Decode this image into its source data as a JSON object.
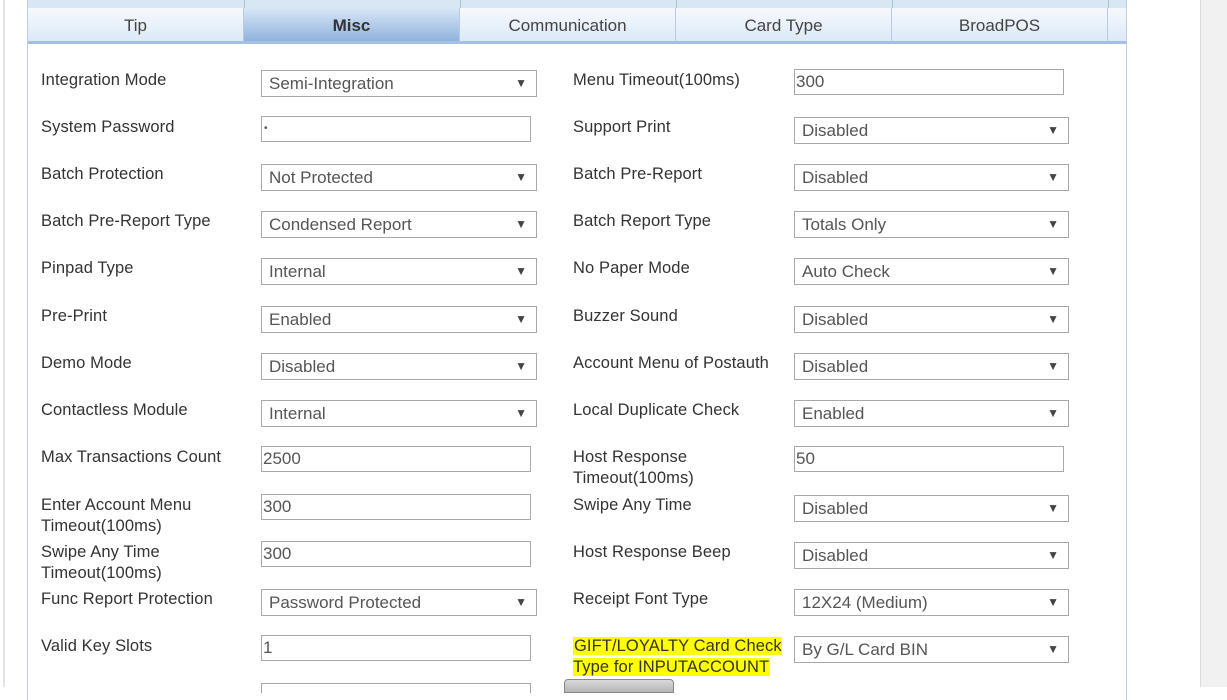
{
  "tabs": [
    {
      "label": "Tip",
      "active": false
    },
    {
      "label": "Misc",
      "active": true
    },
    {
      "label": "Communication",
      "active": false
    },
    {
      "label": "Card Type",
      "active": false
    },
    {
      "label": "BroadPOS",
      "active": false
    }
  ],
  "left_fields": [
    {
      "label": "Integration Mode",
      "type": "select",
      "value": "Semi-Integration"
    },
    {
      "label": "System Password",
      "type": "password",
      "value": "•"
    },
    {
      "label": "Batch Protection",
      "type": "select",
      "value": "Not Protected"
    },
    {
      "label": "Batch Pre-Report Type",
      "type": "select",
      "value": "Condensed Report"
    },
    {
      "label": "Pinpad Type",
      "type": "select",
      "value": "Internal"
    },
    {
      "label": "Pre-Print",
      "type": "select",
      "value": "Enabled"
    },
    {
      "label": "Demo Mode",
      "type": "select",
      "value": "Disabled"
    },
    {
      "label": "Contactless Module",
      "type": "select",
      "value": "Internal"
    },
    {
      "label": "Max Transactions Count",
      "type": "text",
      "value": "2500"
    },
    {
      "label": "Enter Account Menu Timeout(100ms)",
      "type": "text",
      "value": "300"
    },
    {
      "label": "Swipe Any Time Timeout(100ms)",
      "type": "text",
      "value": "300"
    },
    {
      "label": "Func Report Protection",
      "type": "select",
      "value": "Password Protected"
    },
    {
      "label": "Valid Key Slots",
      "type": "text",
      "value": "1"
    }
  ],
  "right_fields": [
    {
      "label": "Menu Timeout(100ms)",
      "type": "text",
      "value": "300"
    },
    {
      "label": "Support Print",
      "type": "select",
      "value": "Disabled"
    },
    {
      "label": "Batch Pre-Report",
      "type": "select",
      "value": "Disabled"
    },
    {
      "label": "Batch Report Type",
      "type": "select",
      "value": "Totals Only"
    },
    {
      "label": "No Paper Mode",
      "type": "select",
      "value": "Auto Check"
    },
    {
      "label": "Buzzer Sound",
      "type": "select",
      "value": "Disabled"
    },
    {
      "label": "Account Menu of Postauth",
      "type": "select",
      "value": "Disabled"
    },
    {
      "label": "Local Duplicate Check",
      "type": "select",
      "value": "Enabled"
    },
    {
      "label": "Host Response Timeout(100ms)",
      "type": "text",
      "value": "50"
    },
    {
      "label": "Swipe Any Time",
      "type": "select",
      "value": "Disabled"
    },
    {
      "label": "Host Response Beep",
      "type": "select",
      "value": "Disabled"
    },
    {
      "label": "Receipt Font Type",
      "type": "select",
      "value": "12X24 (Medium)"
    },
    {
      "label": "GIFT/LOYALTY Card Check Type for INPUTACCOUNT",
      "type": "select",
      "value": "By G/L Card BIN",
      "highlighted": true
    }
  ],
  "colors": {
    "highlight": "#ffff00",
    "tab_active_bottom": "#8fb3de",
    "tab_border": "#a3c1e4"
  },
  "icons": {
    "dropdown": "chevron-down-icon"
  }
}
